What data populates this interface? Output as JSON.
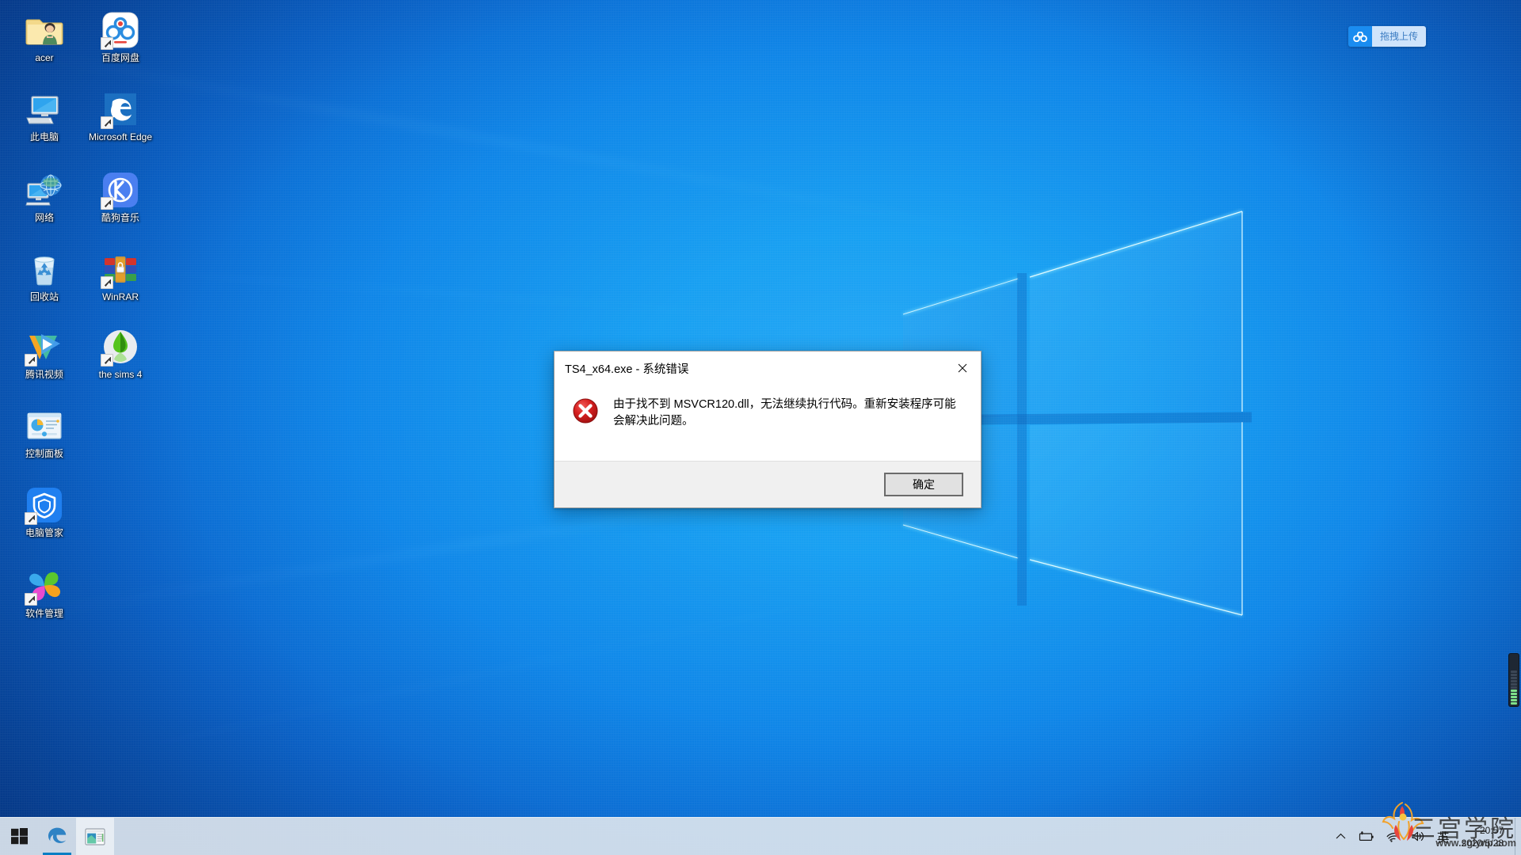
{
  "desktop": {
    "icons": [
      {
        "label": "acer",
        "art": "folder-user-icon",
        "shortcut": false,
        "col": 0,
        "row": 0
      },
      {
        "label": "百度网盘",
        "art": "baidu-netdisk-icon",
        "shortcut": true,
        "col": 1,
        "row": 0
      },
      {
        "label": "此电脑",
        "art": "this-pc-icon",
        "shortcut": false,
        "col": 0,
        "row": 1
      },
      {
        "label": "Microsoft Edge",
        "art": "edge-icon",
        "shortcut": true,
        "col": 1,
        "row": 1
      },
      {
        "label": "网络",
        "art": "network-icon",
        "shortcut": false,
        "col": 0,
        "row": 2
      },
      {
        "label": "酷狗音乐",
        "art": "kugou-music-icon",
        "shortcut": true,
        "col": 1,
        "row": 2
      },
      {
        "label": "回收站",
        "art": "recycle-bin-icon",
        "shortcut": false,
        "col": 0,
        "row": 3
      },
      {
        "label": "WinRAR",
        "art": "winrar-icon",
        "shortcut": true,
        "col": 1,
        "row": 3
      },
      {
        "label": "腾讯视频",
        "art": "tencent-video-icon",
        "shortcut": true,
        "col": 0,
        "row": 4
      },
      {
        "label": "the sims 4",
        "art": "sims4-icon",
        "shortcut": true,
        "col": 1,
        "row": 4
      },
      {
        "label": "控制面板",
        "art": "control-panel-icon",
        "shortcut": false,
        "col": 0,
        "row": 5
      },
      {
        "label": "电脑管家",
        "art": "pc-manager-icon",
        "shortcut": true,
        "col": 0,
        "row": 6
      },
      {
        "label": "软件管理",
        "art": "software-manager-icon",
        "shortcut": true,
        "col": 0,
        "row": 7
      }
    ]
  },
  "upload_widget": {
    "icon": "baidu-cloud-icon",
    "label": "拖拽上传"
  },
  "dialog": {
    "title": "TS4_x64.exe - 系统错误",
    "close_icon": "close-icon",
    "error_icon": "error-circle-icon",
    "message": "由于找不到 MSVCR120.dll，无法继续执行代码。重新安装程序可能会解决此问题。",
    "ok_label": "确定"
  },
  "taskbar": {
    "start_icon": "windows-start-icon",
    "apps": [
      {
        "name": "edge",
        "icon": "edge-icon",
        "state": "running"
      },
      {
        "name": "file-explorer",
        "icon": "file-explorer-icon",
        "state": "active"
      }
    ],
    "tray": [
      {
        "name": "show-hidden-icons",
        "icon": "chevron-up-icon",
        "label": ""
      },
      {
        "name": "battery",
        "icon": "battery-icon",
        "label": ""
      },
      {
        "name": "network",
        "icon": "wifi-icon",
        "label": ""
      },
      {
        "name": "volume",
        "icon": "speaker-icon",
        "label": ""
      },
      {
        "name": "input-method",
        "icon": "ime-icon",
        "label": "英"
      }
    ],
    "clock": {
      "time": "20:57",
      "date": "2020/5/28"
    }
  },
  "watermark": {
    "name": "三宫学院",
    "url": "www.sglynp.com"
  },
  "colors": {
    "accent": "#0a7ec4",
    "wallpaper": "#0f86e8",
    "error_red": "#c31b1b",
    "dialog_footer": "#f0f0f0",
    "upload_badge": "#1a8cf0"
  }
}
